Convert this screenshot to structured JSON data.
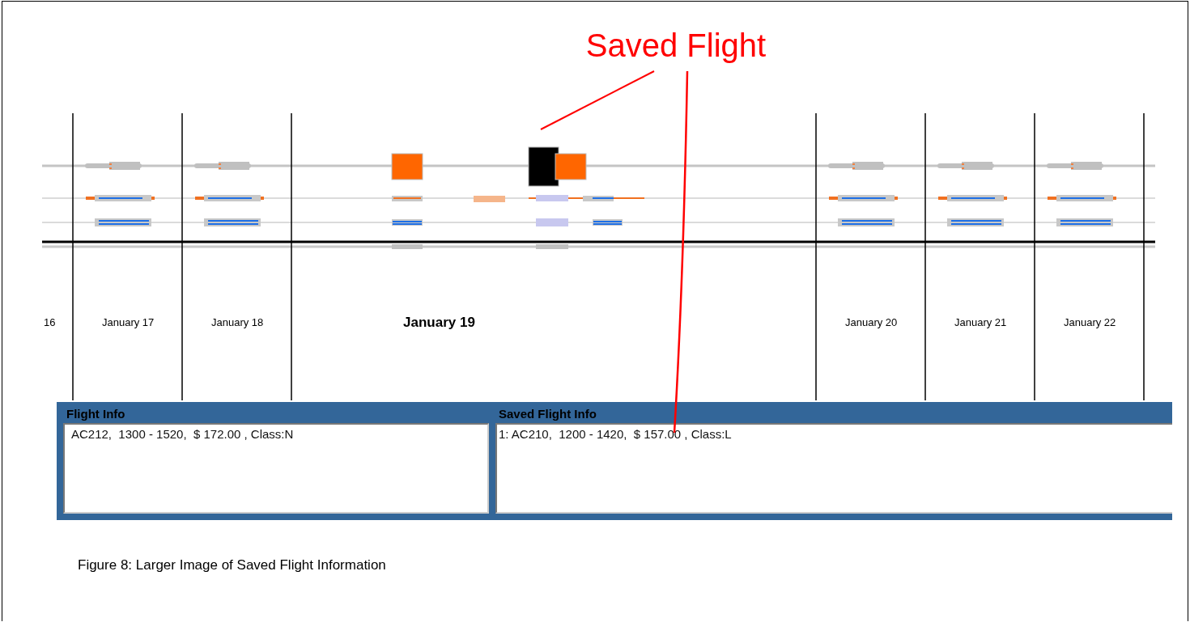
{
  "annotation": {
    "text": "Saved Flight"
  },
  "days": [
    {
      "label": "16",
      "selected": false,
      "partial": true
    },
    {
      "label": "January 17",
      "selected": false
    },
    {
      "label": "January 18",
      "selected": false
    },
    {
      "label": "January 19",
      "selected": true
    },
    {
      "label": "January 20",
      "selected": false
    },
    {
      "label": "January 21",
      "selected": false
    },
    {
      "label": "January 22",
      "selected": false
    }
  ],
  "expanded_flights": [
    {
      "saved": false
    },
    {
      "saved": true
    }
  ],
  "flight_info": {
    "title": "Flight Info",
    "text": "AC212,  1300 - 1520,  $ 172.00 , Class:N"
  },
  "saved_flight_info": {
    "title": "Saved Flight Info",
    "text": "1: AC210,  1200 - 1420,  $ 157.00 , Class:L"
  },
  "caption": "Figure 8: Larger Image of Saved Flight Information"
}
